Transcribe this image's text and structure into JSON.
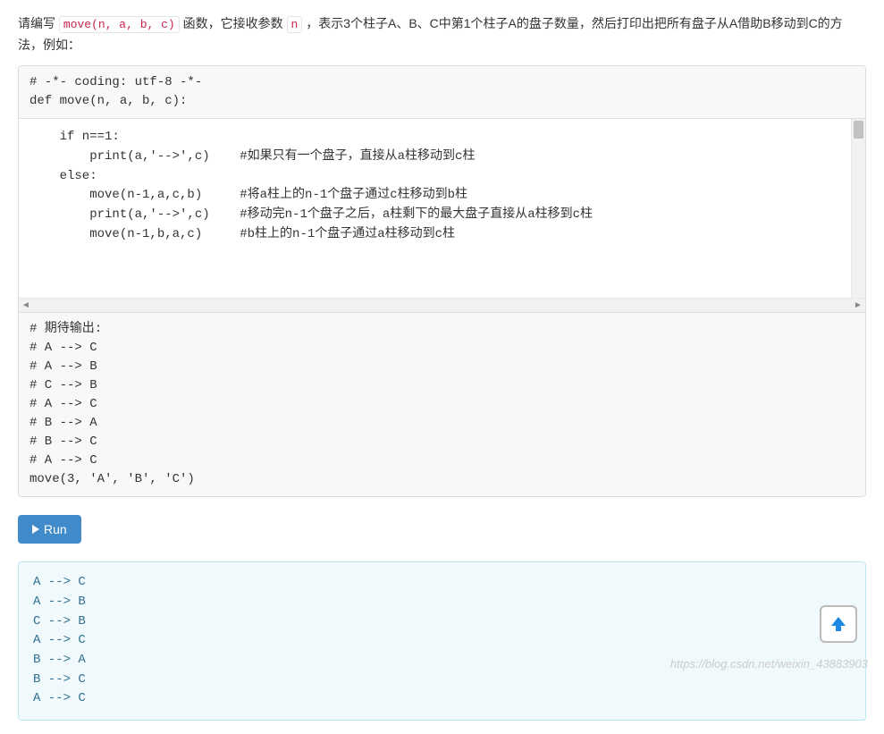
{
  "instruction": {
    "prefix": "请编写 ",
    "code1": "move(n, a, b, c)",
    "mid": " 函数，它接收参数 ",
    "code2": "n",
    "suffix": " ，表示3个柱子A、B、C中第1个柱子A的盘子数量，然后打印出把所有盘子从A借助B移动到C的方法，例如："
  },
  "header_code": "# -*- coding: utf-8 -*-\ndef move(n, a, b, c):",
  "editor_lines": [
    {
      "code": "    if n==1:",
      "comment": ""
    },
    {
      "code": "        print(a,'-->',c)    ",
      "comment": "#如果只有一个盘子，直接从a柱移动到c柱"
    },
    {
      "code": "    else:",
      "comment": ""
    },
    {
      "code": "        move(n-1,a,c,b)     ",
      "comment": "#将a柱上的n-1个盘子通过c柱移动到b柱"
    },
    {
      "code": "        print(a,'-->',c)    ",
      "comment": "#移动完n-1个盘子之后，a柱剩下的最大盘子直接从a柱移到c柱"
    },
    {
      "code": "        move(n-1,b,a,c)     ",
      "comment": "#b柱上的n-1个盘子通过a柱移动到c柱"
    }
  ],
  "footer_code": "# 期待输出:\n# A --> C\n# A --> B\n# C --> B\n# A --> C\n# B --> A\n# B --> C\n# A --> C\nmove(3, 'A', 'B', 'C')",
  "run_label": "Run",
  "output": "A --> C\nA --> B\nC --> B\nA --> C\nB --> A\nB --> C\nA --> C",
  "watermark": "https://blog.csdn.net/weixin_43883903",
  "scroll_arrows": {
    "left": "◄",
    "right": "►"
  }
}
